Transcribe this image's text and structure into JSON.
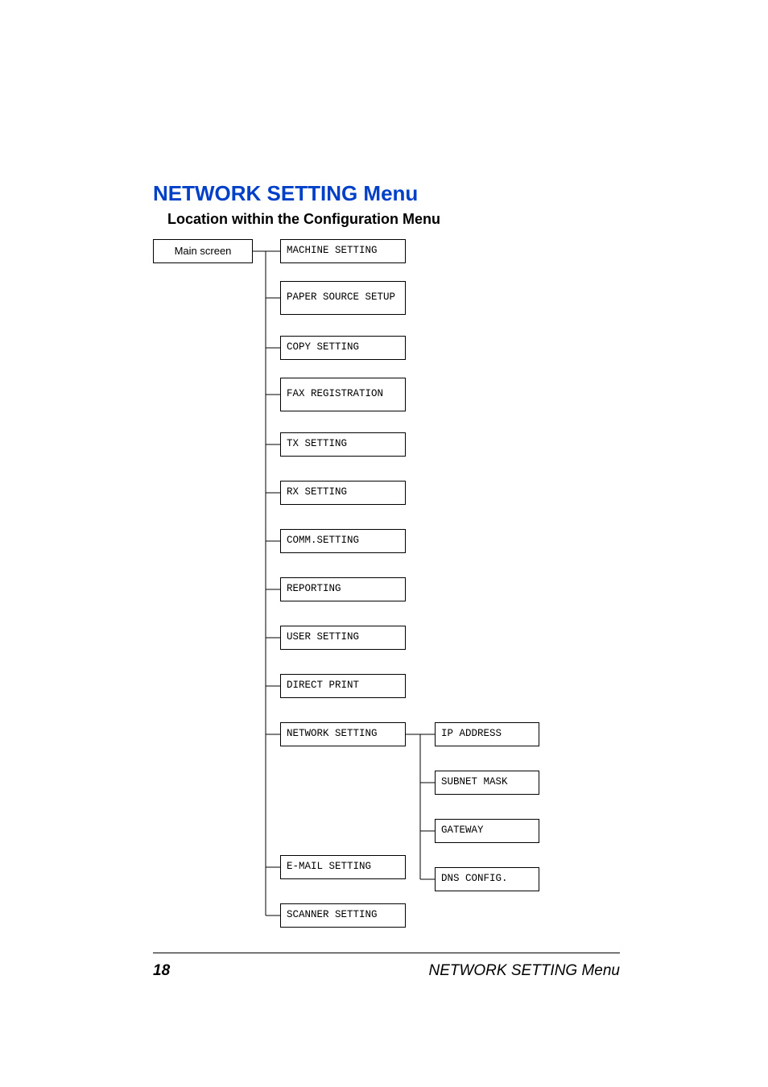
{
  "heading": {
    "title": "NETWORK SETTING Menu",
    "subtitle": "Location within the Configuration Menu"
  },
  "root_box": "Main screen",
  "menu_level1": [
    "MACHINE SETTING",
    "PAPER SOURCE SETUP",
    "COPY SETTING",
    "FAX REGISTRATION",
    "TX SETTING",
    "RX SETTING",
    "COMM.SETTING",
    "REPORTING",
    "USER SETTING",
    "DIRECT PRINT",
    "NETWORK SETTING",
    "E-MAIL SETTING",
    "SCANNER SETTING"
  ],
  "network_submenu": [
    "IP ADDRESS",
    "SUBNET MASK",
    "GATEWAY",
    "DNS CONFIG."
  ],
  "footer": {
    "page_number": "18",
    "title": "NETWORK SETTING Menu"
  }
}
